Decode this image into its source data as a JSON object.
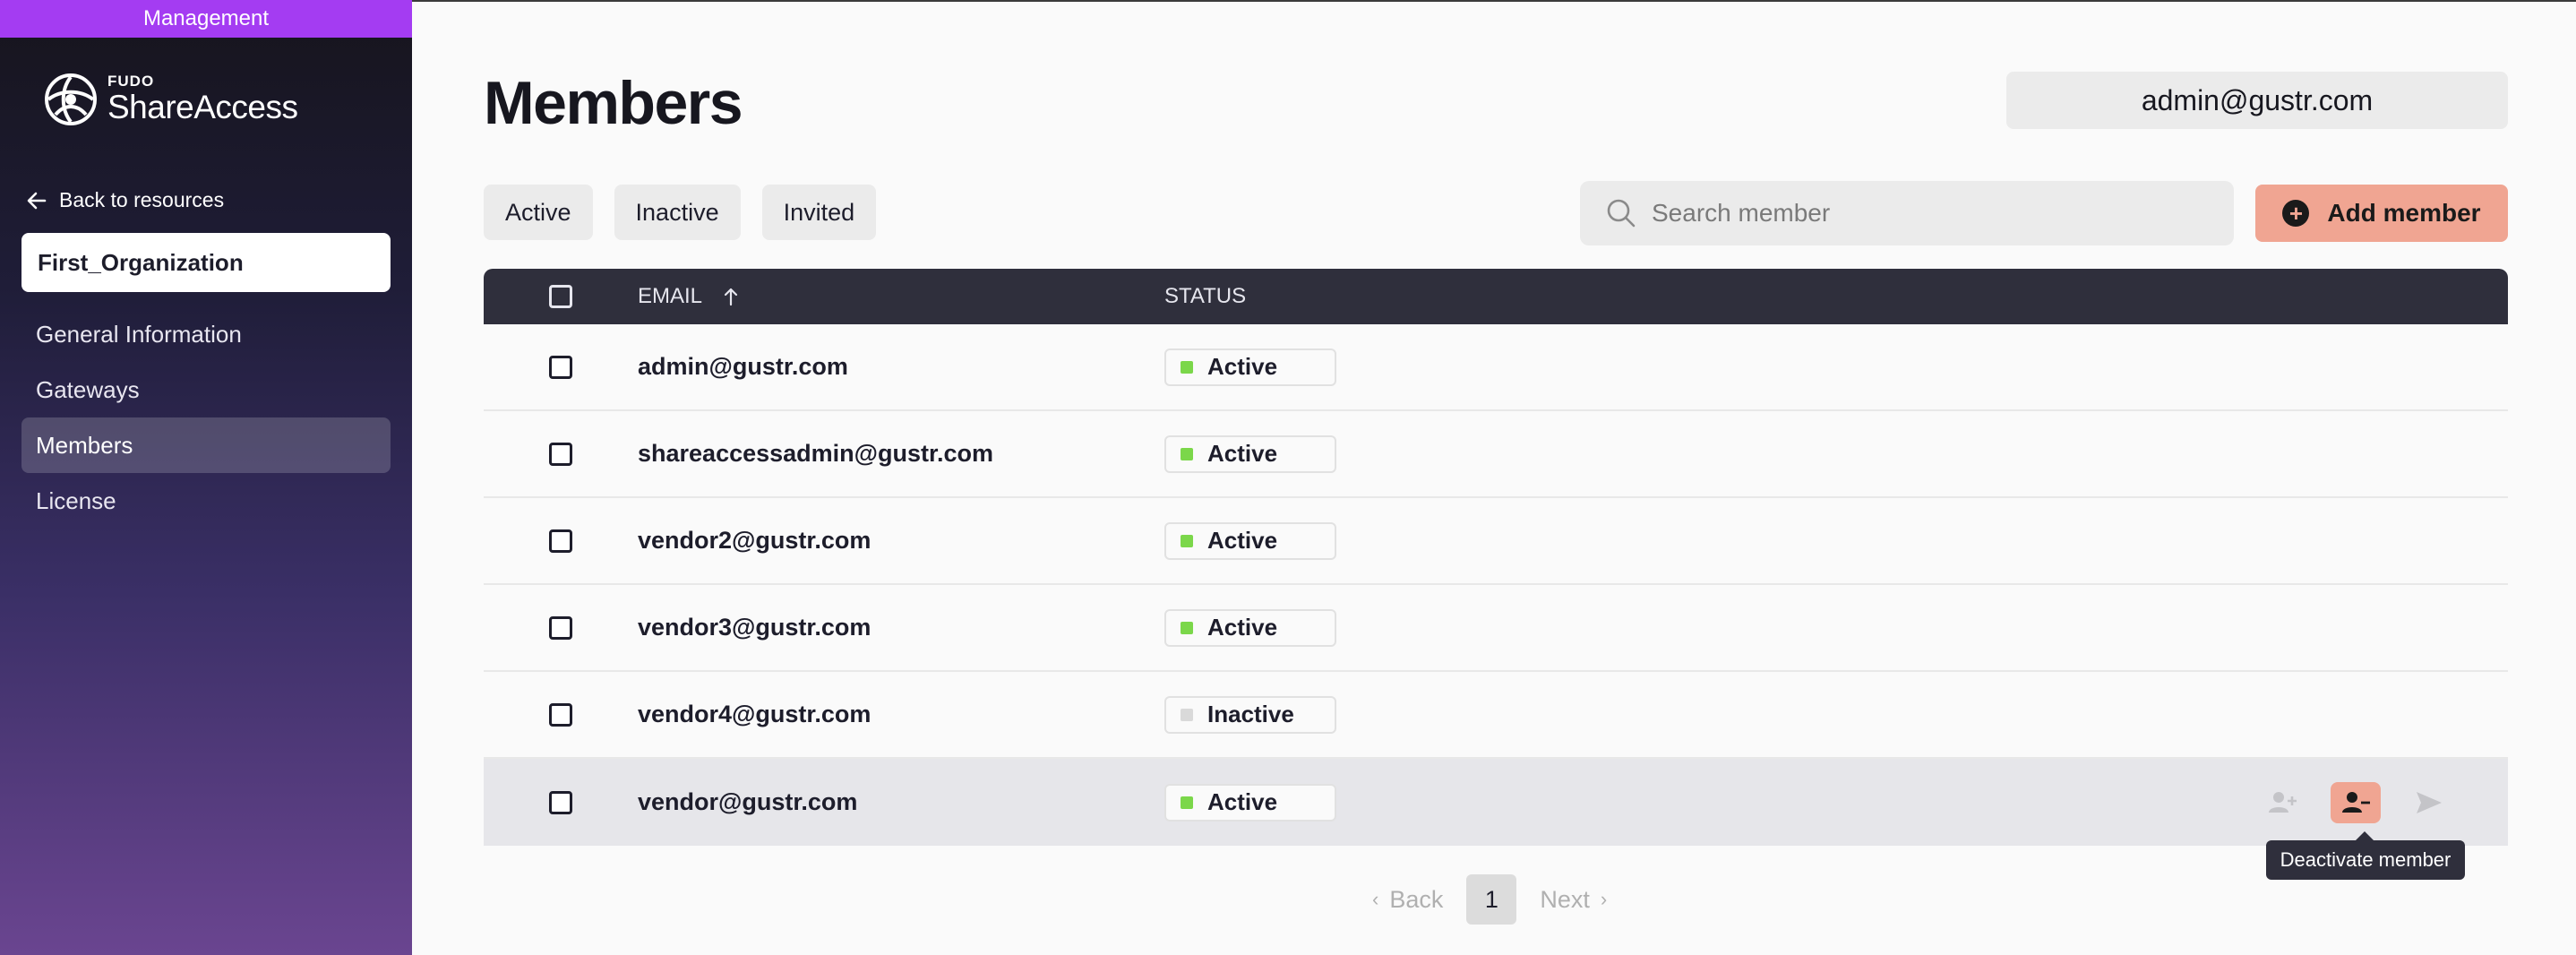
{
  "sidebar": {
    "header": "Management",
    "brand_small": "FUDO",
    "brand_big": "ShareAccess",
    "back_link": "Back to resources",
    "org_name": "First_Organization",
    "nav": [
      "General Information",
      "Gateways",
      "Members",
      "License"
    ],
    "active_nav": "Members"
  },
  "page": {
    "title": "Members",
    "user_email": "admin@gustr.com"
  },
  "filters": [
    "Active",
    "Inactive",
    "Invited"
  ],
  "search": {
    "placeholder": "Search member",
    "value": ""
  },
  "add_button": "Add member",
  "table": {
    "columns": {
      "email": "EMAIL",
      "status": "STATUS"
    },
    "sort": {
      "column": "email",
      "direction": "ascending"
    },
    "rows": [
      {
        "email": "admin@gustr.com",
        "status": "Active"
      },
      {
        "email": "shareaccessadmin@gustr.com",
        "status": "Active"
      },
      {
        "email": "vendor2@gustr.com",
        "status": "Active"
      },
      {
        "email": "vendor3@gustr.com",
        "status": "Active"
      },
      {
        "email": "vendor4@gustr.com",
        "status": "Inactive"
      },
      {
        "email": "vendor@gustr.com",
        "status": "Active"
      }
    ],
    "hovered_row_index": 5
  },
  "row_actions": {
    "icons": [
      "activate-member-icon",
      "deactivate-member-icon",
      "send-invite-icon"
    ],
    "highlighted": "deactivate-member-icon",
    "tooltip": "Deactivate member"
  },
  "pagination": {
    "back": "Back",
    "page": "1",
    "next": "Next"
  },
  "colors": {
    "accent": "#a43cf2",
    "add_button": "#f0a592",
    "table_header": "#2f2f3c",
    "status_active": "#7bd74a",
    "status_inactive": "#d9d9d9"
  }
}
